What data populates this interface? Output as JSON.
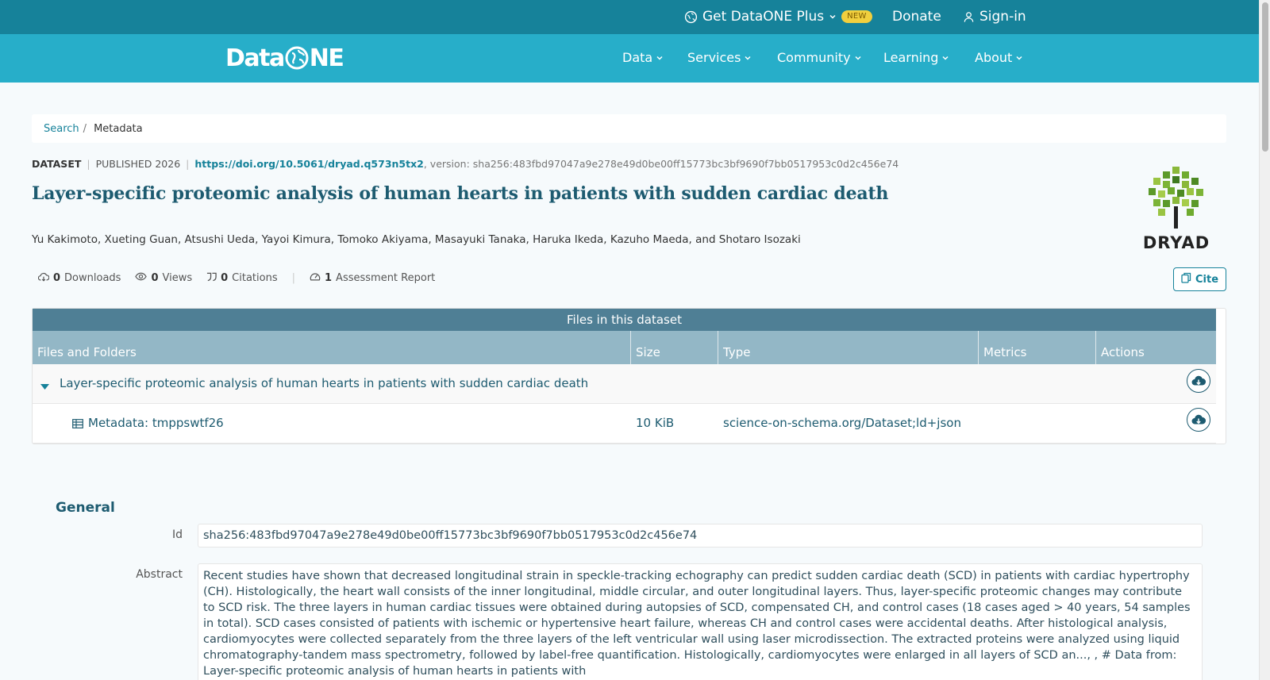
{
  "topbar": {
    "plus_label": "Get DataONE Plus",
    "new_badge": "NEW",
    "donate_label": "Donate",
    "signin_label": "Sign-in"
  },
  "nav": {
    "logo_text": "DataONE",
    "items": [
      {
        "label": "Data"
      },
      {
        "label": "Services"
      },
      {
        "label": "Community"
      },
      {
        "label": "Learning"
      },
      {
        "label": "About"
      }
    ]
  },
  "breadcrumb": {
    "search": "Search",
    "separator": "/",
    "current": "Metadata"
  },
  "dataset": {
    "type_label": "DATASET",
    "published": "PUBLISHED 2026",
    "doi": "https://doi.org/10.5061/dryad.q573n5tx2",
    "version": ", version: sha256:483fbd97047a9e278e49d0be00ff15773bc3bf9690f7bb0517953c0d2c456e74",
    "title": "Layer-specific proteomic analysis of human hearts in patients with sudden cardiac death",
    "authors": "Yu Kakimoto, Xueting Guan, Atsushi Ueda, Yayoi Kimura, Tomoko Akiyama, Masayuki Tanaka, Haruka Ikeda, Kazuho Maeda, and Shotaro Isozaki",
    "repository_logo_text": "DRYAD"
  },
  "metrics": {
    "downloads_count": "0",
    "downloads_label": "Downloads",
    "views_count": "0",
    "views_label": "Views",
    "citations_count": "0",
    "citations_label": "Citations",
    "assessment_count": "1",
    "assessment_label": "Assessment Report",
    "cite_label": "Cite"
  },
  "files": {
    "caption": "Files in this dataset",
    "columns": [
      "Files and Folders",
      "Size",
      "Type",
      "Metrics",
      "Actions"
    ],
    "folder_name": "Layer-specific proteomic analysis of human hearts in patients with sudden cardiac death",
    "rows": [
      {
        "name": "Metadata: tmppswtf26",
        "size": "10 KiB",
        "type": "science-on-schema.org/Dataset;ld+json"
      }
    ]
  },
  "general": {
    "title": "General",
    "id_label": "Id",
    "id_value": "sha256:483fbd97047a9e278e49d0be00ff15773bc3bf9690f7bb0517953c0d2c456e74",
    "abstract_label": "Abstract",
    "abstract_value": "Recent studies have shown that decreased longitudinal strain in speckle-tracking echography can predict sudden cardiac death (SCD) in patients with cardiac hypertrophy (CH). Histologically, the heart wall consists of the inner longitudinal, middle circular, and outer longitudinal layers. Thus, layer-specific proteomic changes may contribute to SCD risk. The three layers in human cardiac tissues were obtained during autopsies of SCD, compensated CH, and control cases (18 cases aged > 40 years, 54 samples in total). SCD cases consisted of patients with ischemic or hypertensive heart failure, whereas CH and control cases were accidental deaths. After histological analysis, cardiomyocytes were collected separately from the three layers of the left ventricular wall using laser microdissection. The extracted proteins were analyzed using liquid chromatography‐tandem mass spectrometry, followed by label-free quantification. Histologically, cardiomyocytes were enlarged in all layers of SCD an..., , # Data from: Layer-specific proteomic analysis of human hearts in patients with"
  }
}
